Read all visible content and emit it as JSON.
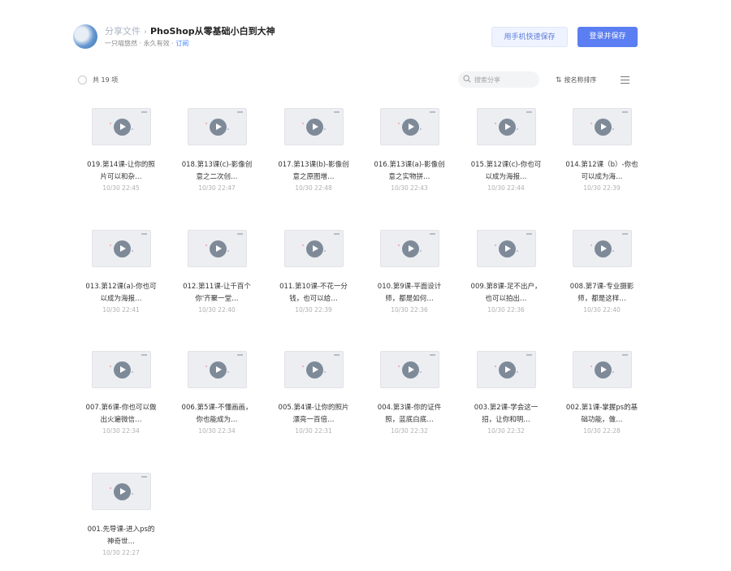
{
  "header": {
    "breadcrumb_link": "分享文件",
    "breadcrumb_sep": "›",
    "title": "PhoShop从零基础小白到大神",
    "sub_text": "一只喵悠然 · 永久有效 · ",
    "sub_link": "订阅"
  },
  "actions": {
    "phone_save_label": "用手机快速保存",
    "login_save_label": "登录并保存"
  },
  "toolbar": {
    "count_label": "共 19 项",
    "search_placeholder": "搜索分享",
    "sort_icon": "⇅",
    "sort_label": "按名称排序"
  },
  "files": [
    {
      "name": "019.第14课-让你的照片可以和杂…",
      "date": "10/30 22:45"
    },
    {
      "name": "018.第13课(c)-影像创意之二次创…",
      "date": "10/30 22:47"
    },
    {
      "name": "017.第13课(b)-影像创意之原图增…",
      "date": "10/30 22:48"
    },
    {
      "name": "016.第13课(a)-影像创意之实物拼…",
      "date": "10/30 22:43"
    },
    {
      "name": "015.第12课(c)-你也可以成为海报…",
      "date": "10/30 22:44"
    },
    {
      "name": "014.第12课（b）-你也可以成为海…",
      "date": "10/30 22:39"
    },
    {
      "name": "013.第12课(a)-你也可以成为海报…",
      "date": "10/30 22:41"
    },
    {
      "name": "012.第11课-让千百个你'齐聚一堂…",
      "date": "10/30 22:40"
    },
    {
      "name": "011.第10课-不花一分钱，也可以给…",
      "date": "10/30 22:39"
    },
    {
      "name": "010.第9课-平面设计师，都是如何…",
      "date": "10/30 22:36"
    },
    {
      "name": "009.第8课-足不出户，也可以拍出…",
      "date": "10/30 22:36"
    },
    {
      "name": "008.第7课-专业摄影师，都是这样…",
      "date": "10/30 22:40"
    },
    {
      "name": "007.第6课-你也可以做出火遍微信…",
      "date": "10/30 22:34"
    },
    {
      "name": "006.第5课-不懂画画，你也能成为…",
      "date": "10/30 22:34"
    },
    {
      "name": "005.第4课-让你的照片漂亮一百倍…",
      "date": "10/30 22:31"
    },
    {
      "name": "004.第3课-你的证件照，蓝底白底…",
      "date": "10/30 22:32"
    },
    {
      "name": "003.第2课-学会这一招，让你和明…",
      "date": "10/30 22:32"
    },
    {
      "name": "002.第1课-掌握ps的基础功能，做…",
      "date": "10/30 22:28"
    },
    {
      "name": "001.先导课-进入ps的神奇世…",
      "date": "10/30 22:27"
    }
  ]
}
